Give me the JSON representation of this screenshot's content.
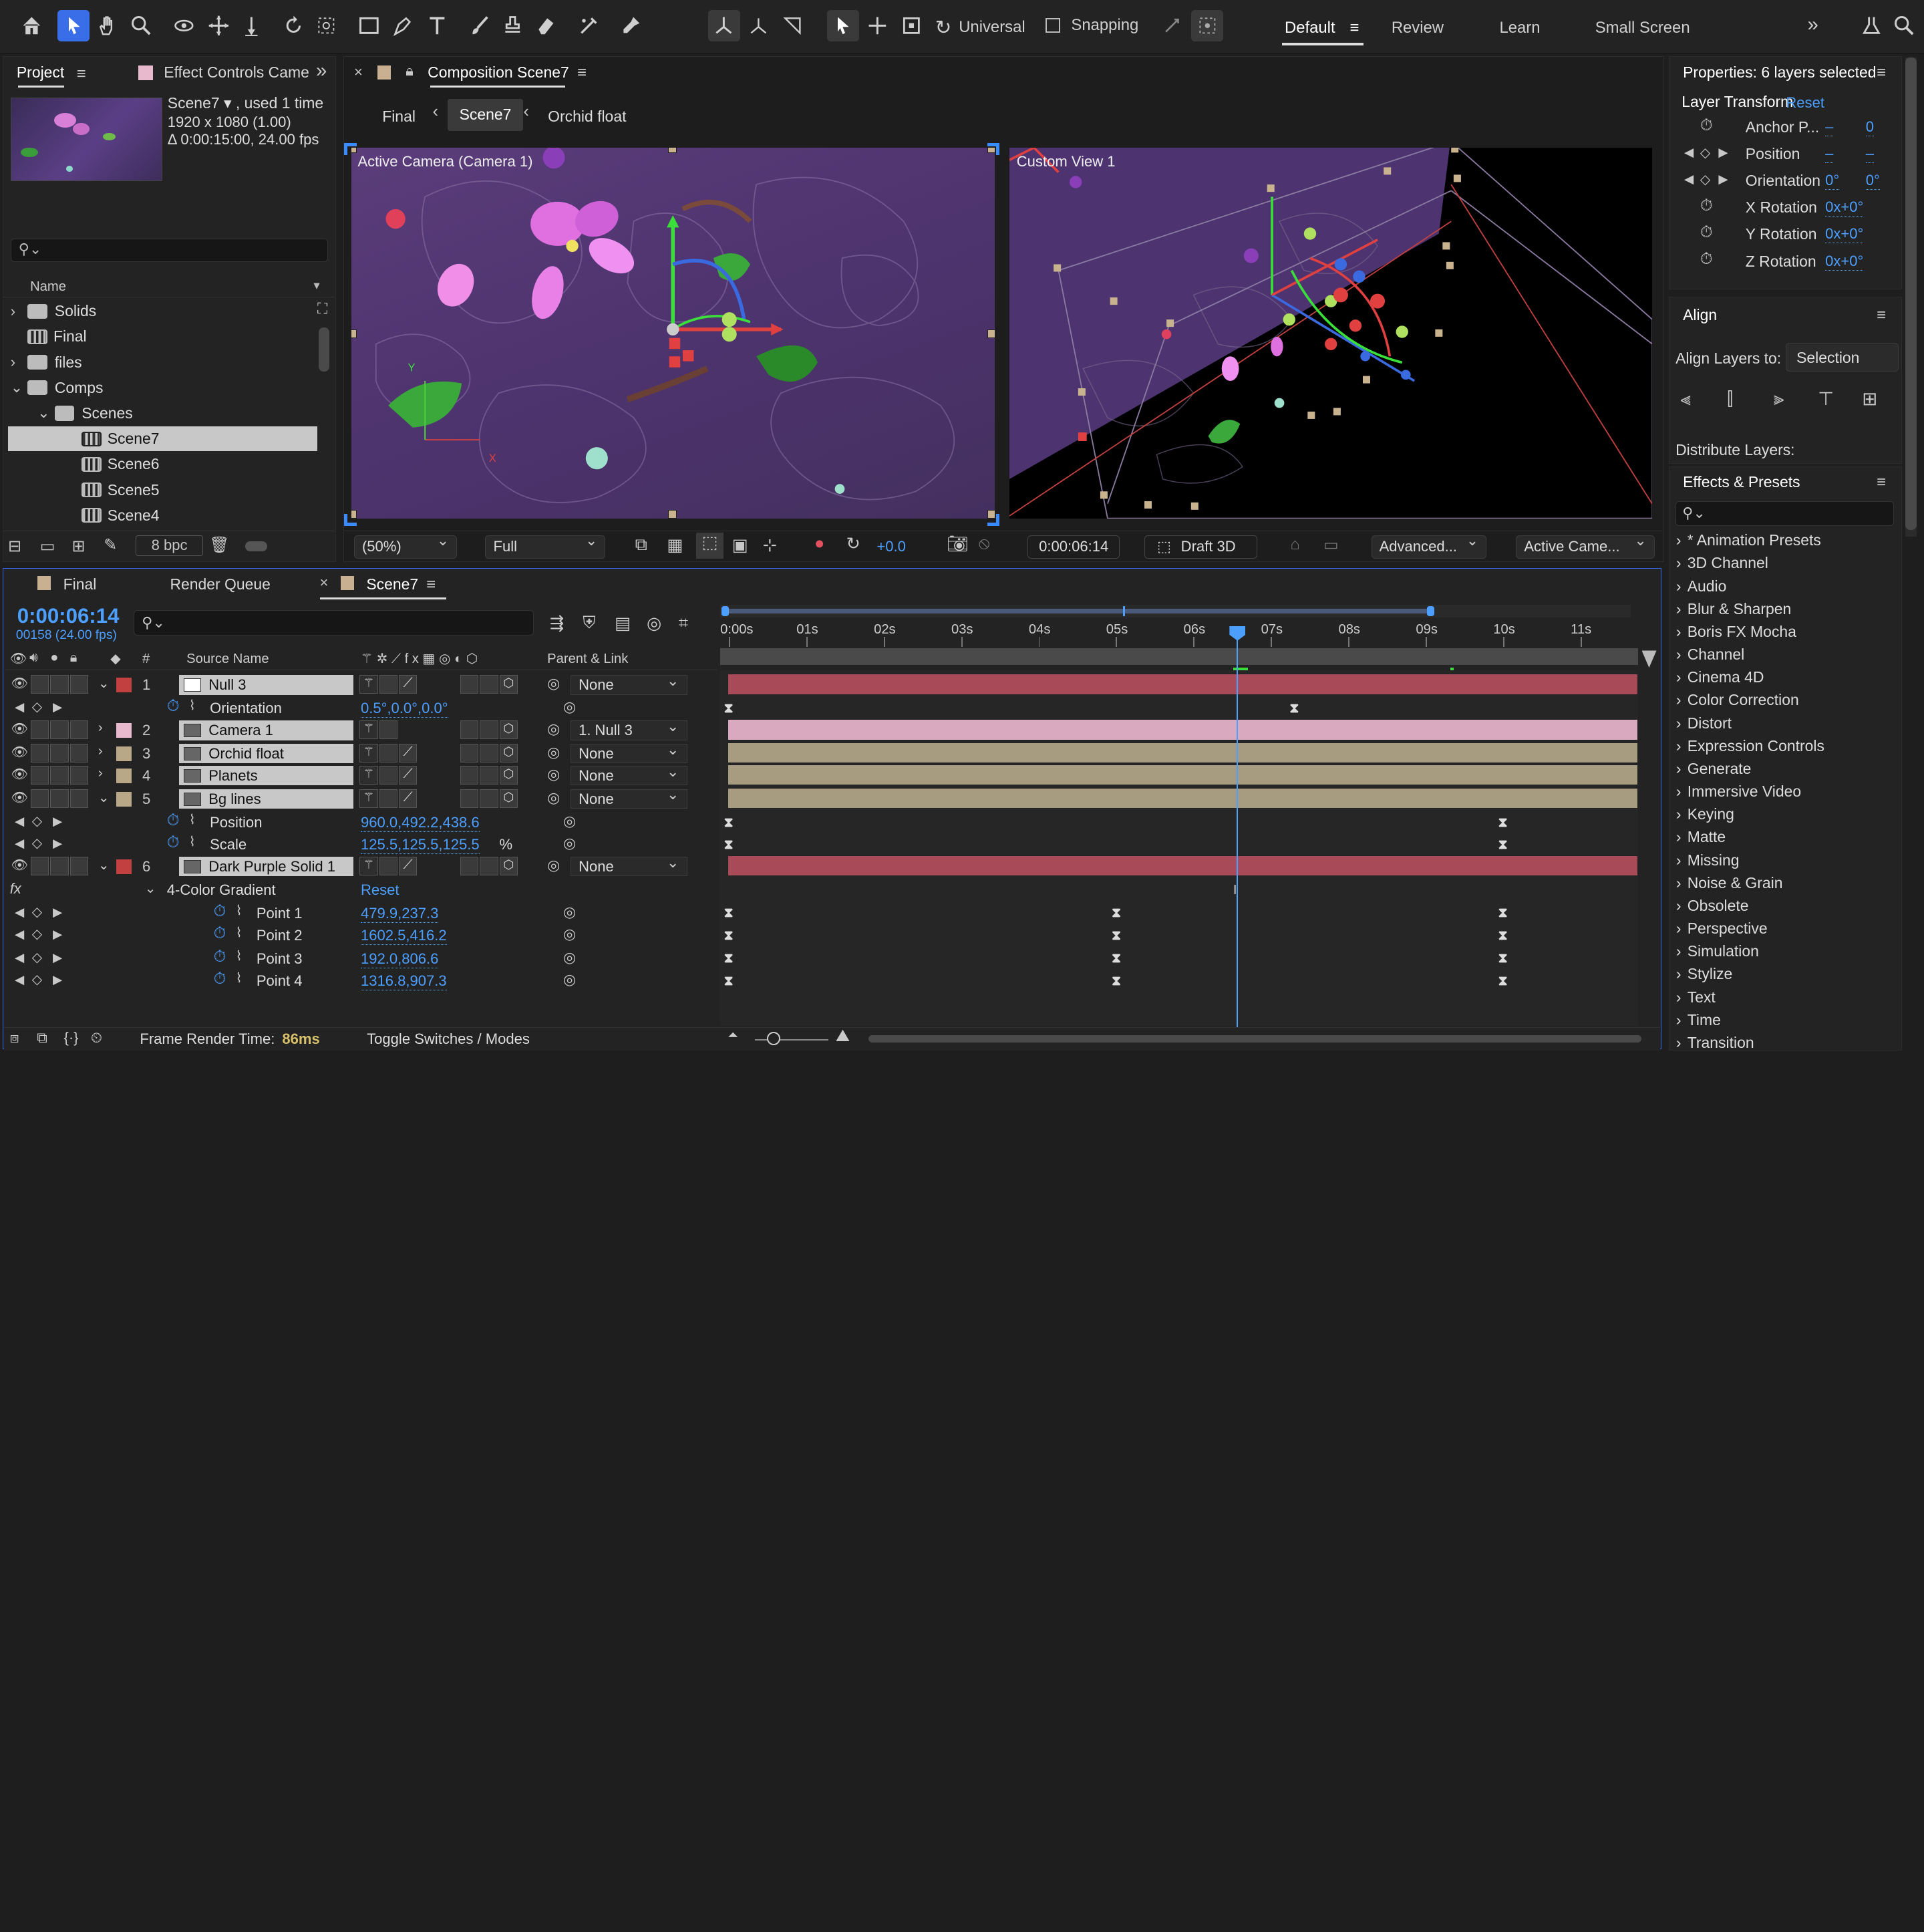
{
  "toolbar": {
    "axis_mode": "Universal",
    "snapping": "Snapping",
    "workspaces": [
      "Default",
      "Review",
      "Learn",
      "Small Screen"
    ],
    "more": "»"
  },
  "project": {
    "tab_project": "Project",
    "tab_effect_controls": "Effect Controls Camer",
    "expand": "»",
    "comp_name": "Scene7 ▾ , used 1 time",
    "comp_size": "1920 x 1080 (1.00)",
    "comp_duration": "Δ 0:00:15:00, 24.00 fps",
    "search_placeholder": "",
    "col_name": "Name",
    "items": [
      {
        "label": "Solids",
        "type": "folder",
        "indent": 0,
        "twirl": "›"
      },
      {
        "label": "Final",
        "type": "comp",
        "indent": 0,
        "twirl": ""
      },
      {
        "label": "files",
        "type": "folder",
        "indent": 0,
        "twirl": "›"
      },
      {
        "label": "Comps",
        "type": "folder",
        "indent": 0,
        "twirl": "⌄"
      },
      {
        "label": "Scenes",
        "type": "folder",
        "indent": 1,
        "twirl": "⌄"
      },
      {
        "label": "Scene7",
        "type": "comp",
        "indent": 2,
        "twirl": "",
        "selected": true
      },
      {
        "label": "Scene6",
        "type": "comp",
        "indent": 2,
        "twirl": ""
      },
      {
        "label": "Scene5",
        "type": "comp",
        "indent": 2,
        "twirl": ""
      },
      {
        "label": "Scene4",
        "type": "comp",
        "indent": 2,
        "twirl": ""
      }
    ],
    "bpc": "8 bpc"
  },
  "composition": {
    "tab": "Composition Scene7",
    "breadcrumbs": [
      "Final",
      "Scene7",
      "Orchid float"
    ],
    "view_left_label": "Active Camera (Camera 1)",
    "view_right_label": "Custom View 1",
    "zoom": "(50%)",
    "resolution": "Full",
    "exposure": "+0.0",
    "timecode": "0:00:06:14",
    "renderer": "Draft 3D",
    "advanced": "Advanced...",
    "camera_view": "Active Came..."
  },
  "properties": {
    "title": "Properties: 6 layers selected",
    "layer_transform": "Layer Transform",
    "reset": "Reset",
    "rows": [
      {
        "label": "Anchor P...",
        "v1": "–",
        "v2": "0",
        "stopwatch": true
      },
      {
        "label": "Position",
        "v1": "–",
        "v2": "–",
        "keyframe": true
      },
      {
        "label": "Orientation",
        "v1": "0°",
        "v2": "0°",
        "keyframe": true
      },
      {
        "label": "X Rotation",
        "v1": "0x+0°",
        "v2": "",
        "stopwatch": true
      },
      {
        "label": "Y Rotation",
        "v1": "0x+0°",
        "v2": "",
        "stopwatch": true
      },
      {
        "label": "Z Rotation",
        "v1": "0x+0°",
        "v2": "",
        "stopwatch": true
      }
    ]
  },
  "align": {
    "title": "Align",
    "align_to_label": "Align Layers to:",
    "align_to_value": "Selection",
    "distribute": "Distribute Layers:"
  },
  "effects": {
    "title": "Effects & Presets",
    "items": [
      "* Animation Presets",
      "3D Channel",
      "Audio",
      "Blur & Sharpen",
      "Boris FX Mocha",
      "Channel",
      "Cinema 4D",
      "Color Correction",
      "Distort",
      "Expression Controls",
      "Generate",
      "Immersive Video",
      "Keying",
      "Matte",
      "Missing",
      "Noise & Grain",
      "Obsolete",
      "Perspective",
      "Simulation",
      "Stylize",
      "Text",
      "Time",
      "Transition"
    ]
  },
  "timeline": {
    "tabs": [
      "Final",
      "Render Queue",
      "Scene7"
    ],
    "timecode": "0:00:06:14",
    "frame_info": "00158 (24.00 fps)",
    "col_source": "Source Name",
    "col_parent": "Parent & Link",
    "ruler": [
      "0:00s",
      "01s",
      "02s",
      "03s",
      "04s",
      "05s",
      "06s",
      "07s",
      "08s",
      "09s",
      "10s",
      "11s"
    ],
    "layers": [
      {
        "num": "1",
        "name": "Null 3",
        "parent": "None",
        "color": "#c24040"
      },
      {
        "num": "2",
        "name": "Camera 1",
        "parent": "1. Null 3",
        "color": "#e8b8cc"
      },
      {
        "num": "3",
        "name": "Orchid float",
        "parent": "None",
        "color": "#b8a888"
      },
      {
        "num": "4",
        "name": "Planets",
        "parent": "None",
        "color": "#b8a888"
      },
      {
        "num": "5",
        "name": "Bg lines",
        "parent": "None",
        "color": "#b8a888"
      },
      {
        "num": "6",
        "name": "Dark Purple Solid 1",
        "parent": "None",
        "color": "#c24040"
      }
    ],
    "props": {
      "orientation": {
        "label": "Orientation",
        "value": "0.5°,0.0°,0.0°"
      },
      "position": {
        "label": "Position",
        "value": "960.0,492.2,438.6"
      },
      "scale": {
        "label": "Scale",
        "value": "125.5,125.5,125.5",
        "unit": "%"
      },
      "effect": {
        "label": "4-Color Gradient",
        "reset": "Reset"
      },
      "points": [
        {
          "label": "Point 1",
          "value": "479.9,237.3"
        },
        {
          "label": "Point 2",
          "value": "1602.5,416.2"
        },
        {
          "label": "Point 3",
          "value": "192.0,806.6"
        },
        {
          "label": "Point 4",
          "value": "1316.8,907.3"
        }
      ]
    },
    "footer_render_label": "Frame Render Time:",
    "footer_render_value": "86ms",
    "footer_toggle": "Toggle Switches / Modes",
    "fx": "fx"
  }
}
